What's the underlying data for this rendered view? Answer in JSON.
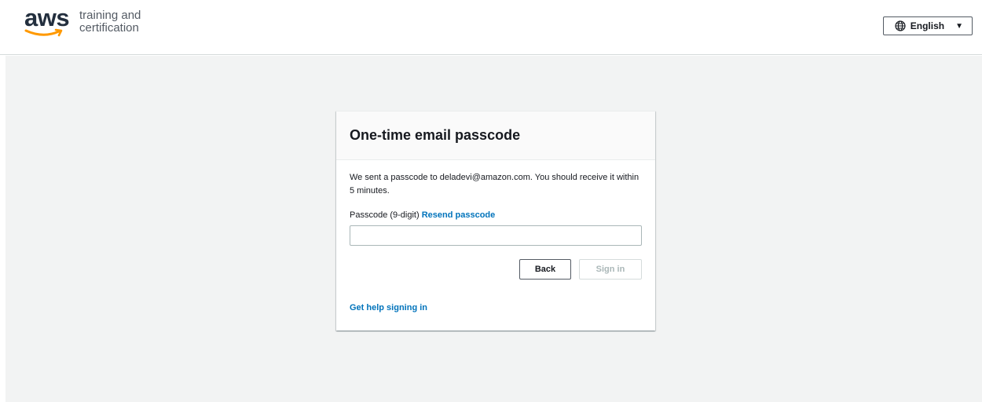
{
  "header": {
    "logo_wordmark": "aws",
    "logo_line1": "training and",
    "logo_line2": "certification",
    "language_label": "English",
    "globe_icon": "globe-icon",
    "caret_icon": "caret-down-icon"
  },
  "card": {
    "title": "One-time email passcode",
    "description": "We sent a passcode to deladevi@amazon.com. You should receive it within 5 minutes.",
    "passcode_label": "Passcode (9-digit)",
    "resend_label": "Resend passcode",
    "passcode_value": "",
    "back_label": "Back",
    "signin_label": "Sign in",
    "help_label": "Get help signing in"
  },
  "colors": {
    "link": "#0073bb",
    "background": "#f2f3f3",
    "text": "#16191f",
    "logo_orange": "#ff9900"
  }
}
